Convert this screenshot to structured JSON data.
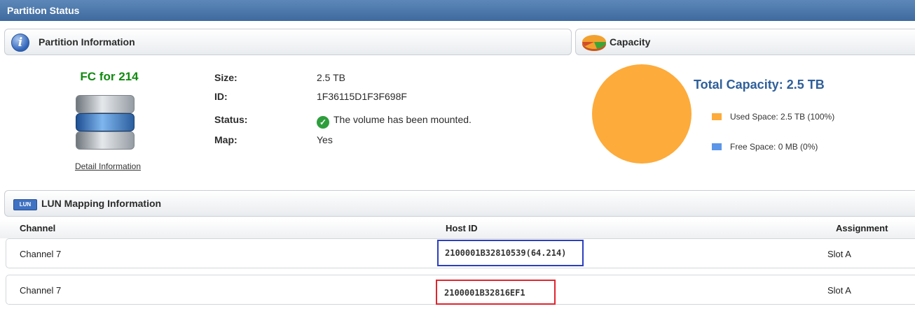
{
  "window": {
    "title": "Partition Status"
  },
  "partition_info": {
    "header": "Partition Information",
    "volume_name": "FC for 214",
    "detail_link": "Detail Information",
    "fields": [
      {
        "label": "Size:",
        "value": "2.5 TB"
      },
      {
        "label": "ID:",
        "value": "1F36115D1F3F698F"
      },
      {
        "label": "Status:",
        "value": "The volume has been mounted."
      },
      {
        "label": "Map:",
        "value": "Yes"
      }
    ]
  },
  "capacity": {
    "header": "Capacity",
    "total": "Total Capacity: 2.5 TB",
    "legend": [
      {
        "label": "Used Space: 2.5 TB (100%)",
        "color": "#fdab3b"
      },
      {
        "label": "Free Space: 0 MB (0%)",
        "color": "#5b96e8"
      }
    ],
    "used_fraction": 1.0
  },
  "lun_mapping": {
    "header": "LUN Mapping Information",
    "icon_text": "LUN",
    "columns": [
      "Channel",
      "Host ID",
      "Assignment"
    ],
    "rows": [
      {
        "channel": "Channel 7",
        "host_id": "2100001B32810539(64.214)",
        "assignment": "Slot A",
        "highlight": "#2c3fbf"
      },
      {
        "channel": "Channel 7",
        "host_id": "2100001B32816EF1",
        "assignment": "Slot A",
        "highlight": "#e0242f"
      }
    ]
  }
}
